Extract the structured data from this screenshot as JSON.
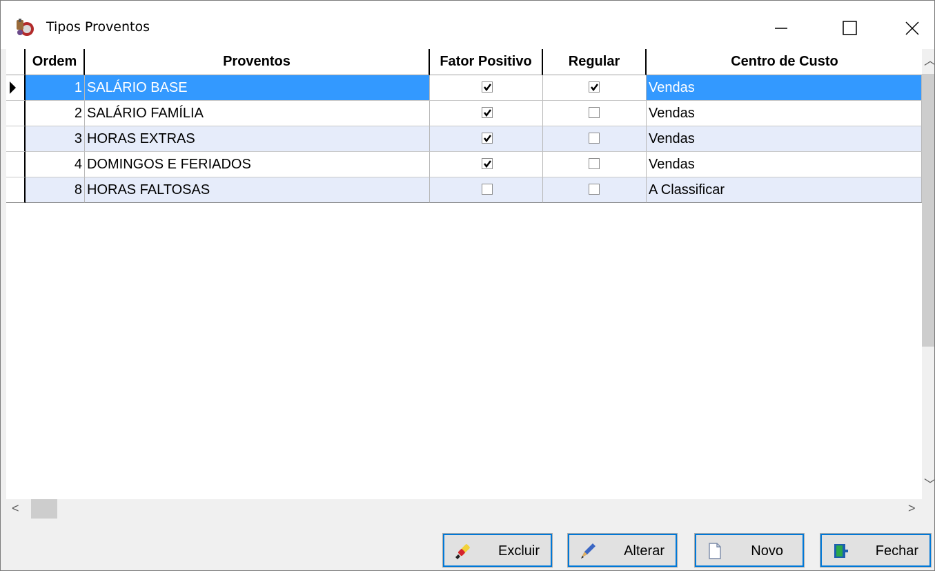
{
  "window": {
    "title": "Tipos Proventos"
  },
  "grid": {
    "columns": [
      "Ordem",
      "Proventos",
      "Fator Positivo",
      "Regular",
      "Centro de Custo"
    ],
    "rows": [
      {
        "ordem": "1",
        "provento": "SALÁRIO BASE",
        "fator_positivo": true,
        "regular": true,
        "centro": "Vendas",
        "selected": true
      },
      {
        "ordem": "2",
        "provento": "SALÁRIO FAMÍLIA",
        "fator_positivo": true,
        "regular": false,
        "centro": "Vendas"
      },
      {
        "ordem": "3",
        "provento": "HORAS EXTRAS",
        "fator_positivo": true,
        "regular": false,
        "centro": "Vendas"
      },
      {
        "ordem": "4",
        "provento": "DOMINGOS E FERIADOS",
        "fator_positivo": true,
        "regular": false,
        "centro": "Vendas"
      },
      {
        "ordem": "8",
        "provento": "HORAS FALTOSAS",
        "fator_positivo": false,
        "regular": false,
        "centro": "A Classificar"
      }
    ]
  },
  "buttons": {
    "excluir": "Excluir",
    "alterar": "Alterar",
    "novo": "Novo",
    "fechar": "Fechar"
  },
  "colors": {
    "selection": "#3399ff",
    "alt_row": "#e6ecfa",
    "focus_outline": "#0078d7"
  }
}
